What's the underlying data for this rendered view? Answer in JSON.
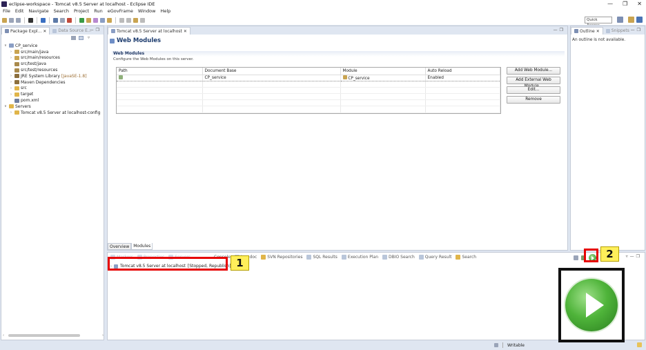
{
  "window": {
    "title": "eclipse-workspace - Tomcat v8.5 Server at localhost - Eclipse IDE",
    "controls": [
      "—",
      "❐",
      "✕"
    ]
  },
  "menu": [
    "File",
    "Edit",
    "Navigate",
    "Search",
    "Project",
    "Run",
    "eGovFrame",
    "Window",
    "Help"
  ],
  "toolbar": {
    "quick_access": "Quick Access"
  },
  "package_explorer": {
    "tabs": [
      "Package Expl...",
      "Data Source E..."
    ],
    "tree": [
      {
        "label": "CP_service",
        "depth": 0,
        "expanded": true,
        "icon": "project-icon"
      },
      {
        "label": "src/main/java",
        "depth": 1,
        "icon": "source-folder-icon"
      },
      {
        "label": "src/main/resources",
        "depth": 1,
        "icon": "source-folder-icon"
      },
      {
        "label": "src/test/java",
        "depth": 1,
        "icon": "source-folder-icon"
      },
      {
        "label": "src/test/resources",
        "depth": 1,
        "icon": "source-folder-icon"
      },
      {
        "label": "JRE System Library",
        "decor": " [JavaSE-1.8]",
        "depth": 1,
        "icon": "library-icon"
      },
      {
        "label": "Maven Dependencies",
        "depth": 1,
        "icon": "library-icon"
      },
      {
        "label": "src",
        "depth": 1,
        "icon": "folder-icon"
      },
      {
        "label": "target",
        "depth": 1,
        "icon": "folder-icon"
      },
      {
        "label": "pom.xml",
        "depth": 1,
        "icon": "xml-file-icon"
      },
      {
        "label": "Servers",
        "depth": 0,
        "expanded": true,
        "icon": "folder-icon"
      },
      {
        "label": "Tomcat v8.5 Server at localhost-config",
        "depth": 1,
        "icon": "folder-icon"
      }
    ]
  },
  "editor": {
    "tab": "Tomcat v8.5 Server at localhost",
    "title": "Web Modules",
    "section_title": "Web Modules",
    "section_desc": "Configure the Web Modules on this server.",
    "columns": [
      "Path",
      "Document Base",
      "Module",
      "Auto Reload"
    ],
    "rows": [
      {
        "path": "",
        "document_base": "CP_service",
        "module": "CP_service",
        "auto_reload": "Enabled"
      }
    ],
    "buttons": [
      "Add Web Module...",
      "Add External Web Module...",
      "Edit...",
      "Remove"
    ],
    "page_tabs": [
      "Overview",
      "Modules"
    ]
  },
  "outline": {
    "tabs": [
      "Outline",
      "Snippets"
    ],
    "message": "An outline is not available."
  },
  "bottom_panel": {
    "tabs": [
      "Console",
      "Javadoc",
      "SVN Repositories",
      "SQL Results",
      "Execution Plan",
      "DBIO Search",
      "Query Result",
      "Search"
    ],
    "faded_tabs": [
      "Markers",
      "Properties",
      "Servers"
    ],
    "server_name": "Tomcat v8.5 Server at localhost",
    "server_status": "[Stopped, Republish]"
  },
  "annotations": {
    "callout_1": "1",
    "callout_2": "2"
  },
  "status": {
    "writable": "Writable"
  },
  "colors": {
    "highlight": "#e60000",
    "callout_bg": "#ffef5a",
    "play_green": "#4fb43a"
  }
}
